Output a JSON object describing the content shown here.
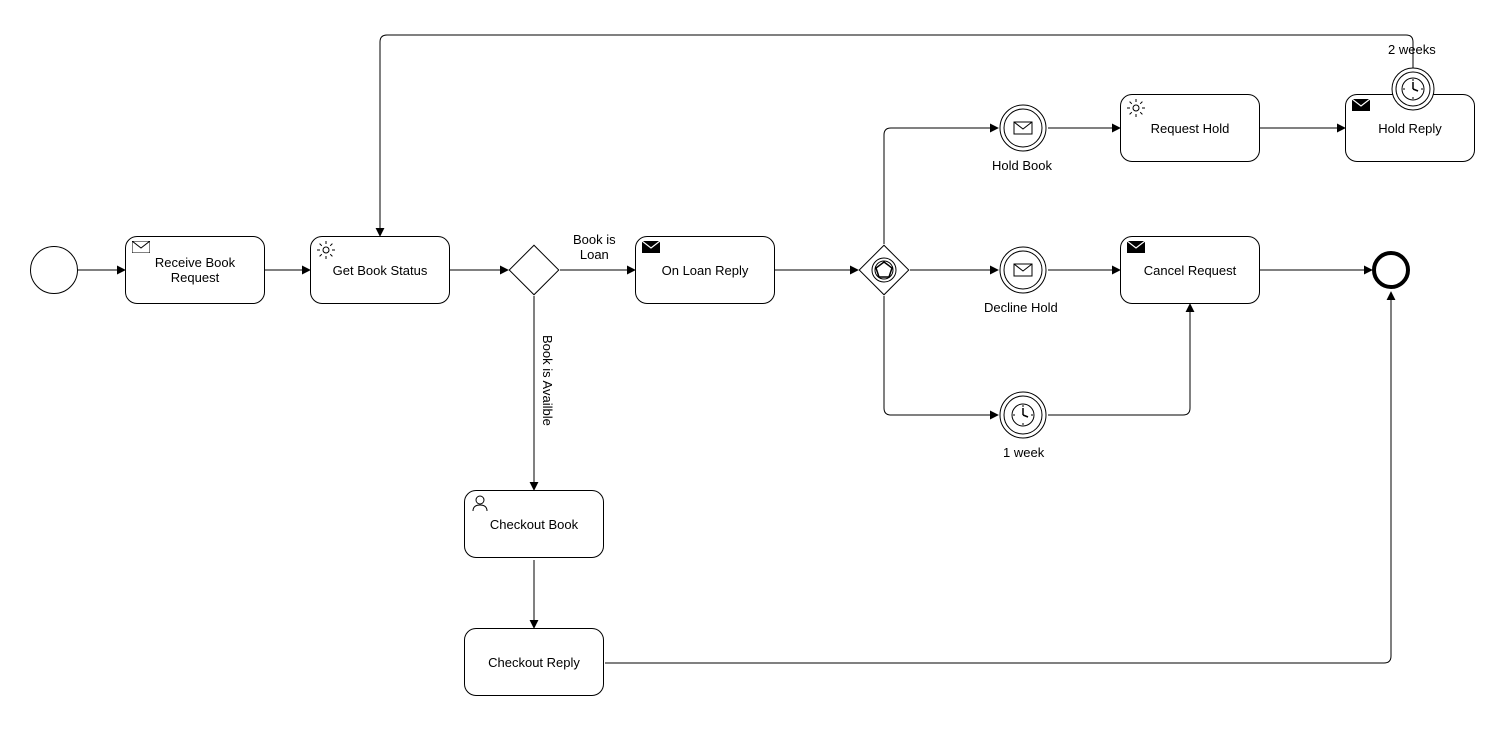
{
  "tasks": {
    "receiveBookRequest": "Receive Book\nRequest",
    "getBookStatus": "Get Book Status",
    "onLoanReply": "On Loan Reply",
    "requestHold": "Request Hold",
    "holdReply": "Hold Reply",
    "cancelRequest": "Cancel Request",
    "checkoutBook": "Checkout Book",
    "checkoutReply": "Checkout Reply"
  },
  "events": {
    "holdBook": "Hold Book",
    "declineHold": "Decline Hold",
    "oneWeek": "1 week",
    "twoWeeks": "2 weeks"
  },
  "edges": {
    "bookIsLoan": "Book is\nLoan",
    "bookIsAvailable": "Book is Availble"
  }
}
